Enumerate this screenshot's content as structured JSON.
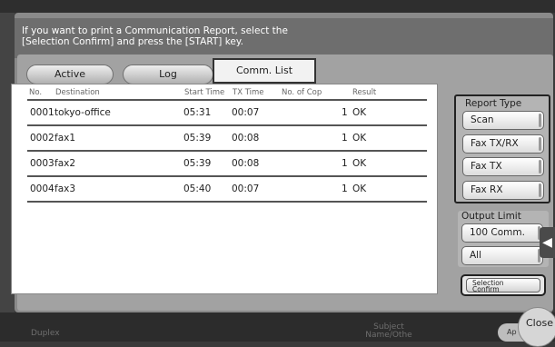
{
  "header": {
    "message_line1": "If you want to print a Communication Report, select the",
    "message_line2": "[Selection Confirm] and press the [START] key."
  },
  "tabs": [
    {
      "label": "Active",
      "selected": false
    },
    {
      "label": "Log",
      "selected": false
    },
    {
      "label": "Comm. List",
      "selected": true
    }
  ],
  "table": {
    "columns": [
      "No.",
      "Destination",
      "Start Time",
      "TX Time",
      "No. of Cop",
      "Result"
    ],
    "rows": [
      {
        "no": "0001",
        "destination": "tokyo-office",
        "start": "05:31",
        "tx": "00:07",
        "copies": "1",
        "result": "OK"
      },
      {
        "no": "0002",
        "destination": "fax1",
        "start": "05:39",
        "tx": "00:08",
        "copies": "1",
        "result": "OK"
      },
      {
        "no": "0003",
        "destination": "fax2",
        "start": "05:39",
        "tx": "00:08",
        "copies": "1",
        "result": "OK"
      },
      {
        "no": "0004",
        "destination": "fax3",
        "start": "05:40",
        "tx": "00:07",
        "copies": "1",
        "result": "OK"
      }
    ]
  },
  "report_type": {
    "title": "Report Type",
    "options": [
      "Scan",
      "Fax TX/RX",
      "Fax TX",
      "Fax RX"
    ]
  },
  "output_limit": {
    "title": "Output Limit",
    "options": [
      "100 Comm.",
      "All"
    ]
  },
  "selection_confirm": {
    "line1": "Selection",
    "line2": "Confirm"
  },
  "close_label": "Close",
  "app_label": "Ap",
  "background_labels": {
    "duplex": "Duplex",
    "subject_line1": "Subject",
    "subject_line2": "Name/Othe"
  },
  "icons": {
    "side_arrow": "chevron-left-icon"
  },
  "colors": {
    "selected_border": "#222222",
    "panel": "#a2a2a2"
  }
}
